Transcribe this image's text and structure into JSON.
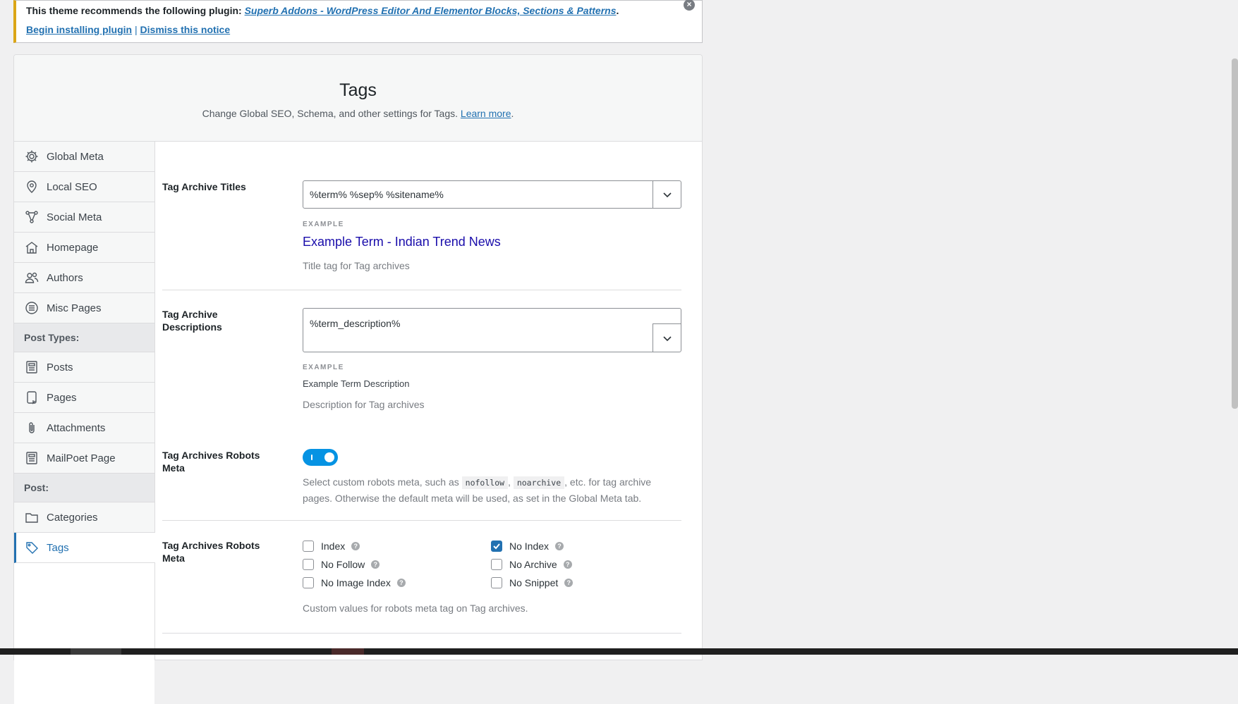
{
  "notice": {
    "text": "This theme recommends the following plugin:",
    "plugin_link": "Superb Addons - WordPress Editor And Elementor Blocks, Sections & Patterns",
    "period": ".",
    "install_link": "Begin installing plugin",
    "separator": "|",
    "dismiss_link": "Dismiss this notice"
  },
  "header": {
    "title": "Tags",
    "subtitle": "Change Global SEO, Schema, and other settings for Tags.",
    "learn_more": "Learn more",
    "period": "."
  },
  "sidebar": {
    "items": [
      {
        "label": "Global Meta",
        "icon": "gear-icon"
      },
      {
        "label": "Local SEO",
        "icon": "map-pin-icon"
      },
      {
        "label": "Social Meta",
        "icon": "share-icon"
      },
      {
        "label": "Homepage",
        "icon": "home-icon"
      },
      {
        "label": "Authors",
        "icon": "users-icon"
      },
      {
        "label": "Misc Pages",
        "icon": "list-circle-icon"
      }
    ],
    "section_post_types": "Post Types:",
    "post_types": [
      {
        "label": "Posts",
        "icon": "document-icon"
      },
      {
        "label": "Pages",
        "icon": "pages-icon"
      },
      {
        "label": "Attachments",
        "icon": "paperclip-icon"
      },
      {
        "label": "MailPoet Page",
        "icon": "document-icon"
      }
    ],
    "section_post": "Post:",
    "post": [
      {
        "label": "Categories",
        "icon": "folder-icon"
      },
      {
        "label": "Tags",
        "icon": "tag-icon",
        "active": true
      }
    ]
  },
  "titles": {
    "label": "Tag Archive Titles",
    "value": "%term% %sep% %sitename%",
    "example_label": "EXAMPLE",
    "example_value": "Example Term - Indian Trend News",
    "description": "Title tag for Tag archives"
  },
  "descriptions": {
    "label": "Tag Archive Descriptions",
    "value": "%term_description%",
    "example_label": "EXAMPLE",
    "example_value": "Example Term Description",
    "description": "Description for Tag archives"
  },
  "robots_toggle": {
    "label": "Tag Archives Robots Meta",
    "enabled": true,
    "desc_before": "Select custom robots meta, such as",
    "code1": "nofollow",
    "comma": ",",
    "code2": "noarchive",
    "desc_after": ", etc. for tag archive pages. Otherwise the default meta will be used, as set in the Global Meta tab."
  },
  "robots_options": {
    "label": "Tag Archives Robots Meta",
    "options": [
      {
        "label": "Index",
        "checked": false
      },
      {
        "label": "No Index",
        "checked": true
      },
      {
        "label": "No Follow",
        "checked": false
      },
      {
        "label": "No Archive",
        "checked": false
      },
      {
        "label": "No Image Index",
        "checked": false
      },
      {
        "label": "No Snippet",
        "checked": false
      }
    ],
    "help_glyph": "?",
    "description": "Custom values for robots meta tag on Tag archives."
  },
  "colors": {
    "accent": "#2271b1",
    "toggle": "#0693e3",
    "notice_border": "#dba617",
    "example_link": "#1a0dab"
  }
}
